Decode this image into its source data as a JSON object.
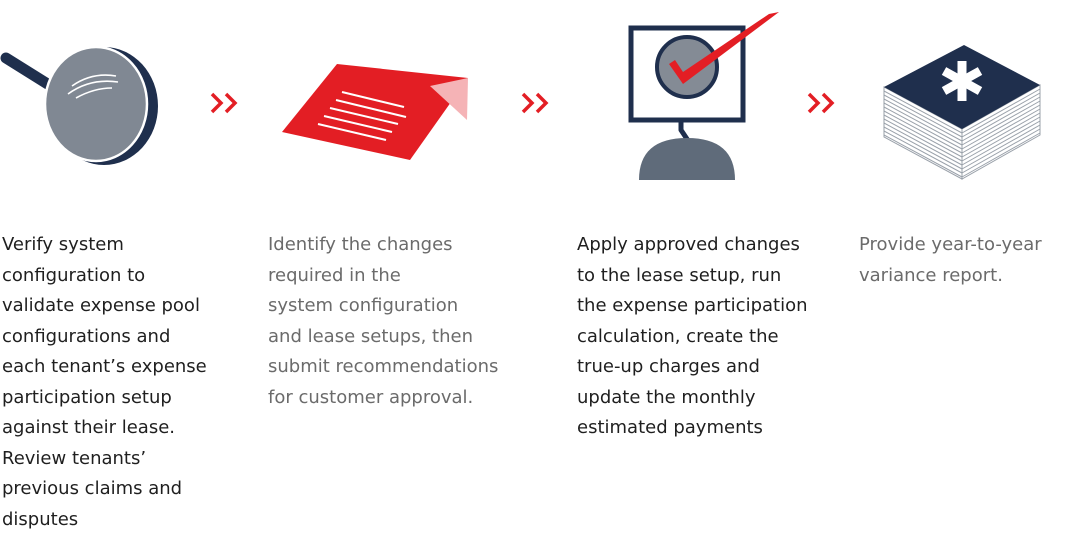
{
  "colors": {
    "red": "#e31e24",
    "navy": "#1f2f4d",
    "slate": "#5f6b7a",
    "gray_text": "#6b6b6b",
    "dark_text": "#1f1f1f"
  },
  "steps": [
    {
      "icon": "magnifying-glass-icon",
      "text": "Verify system\nconfiguration to\nvalidate expense pool\nconfigurations and\neach tenant’s expense\nparticipation setup\nagainst their lease.\nReview tenants’\nprevious claims and\ndisputes"
    },
    {
      "icon": "document-icon",
      "text": "Identify the changes\nrequired in the\nsystem configuration\nand lease setups, then\nsubmit recommendations\nfor customer approval."
    },
    {
      "icon": "monitor-checkmark-icon",
      "text": "Apply approved changes\nto the lease setup, run\nthe expense participation\ncalculation, create the\ntrue-up charges and\nupdate the monthly\nestimated payments"
    },
    {
      "icon": "report-stack-icon",
      "text": "Provide year-to-year\nvariance report."
    }
  ],
  "arrow_icon": "double-chevron-right-icon"
}
